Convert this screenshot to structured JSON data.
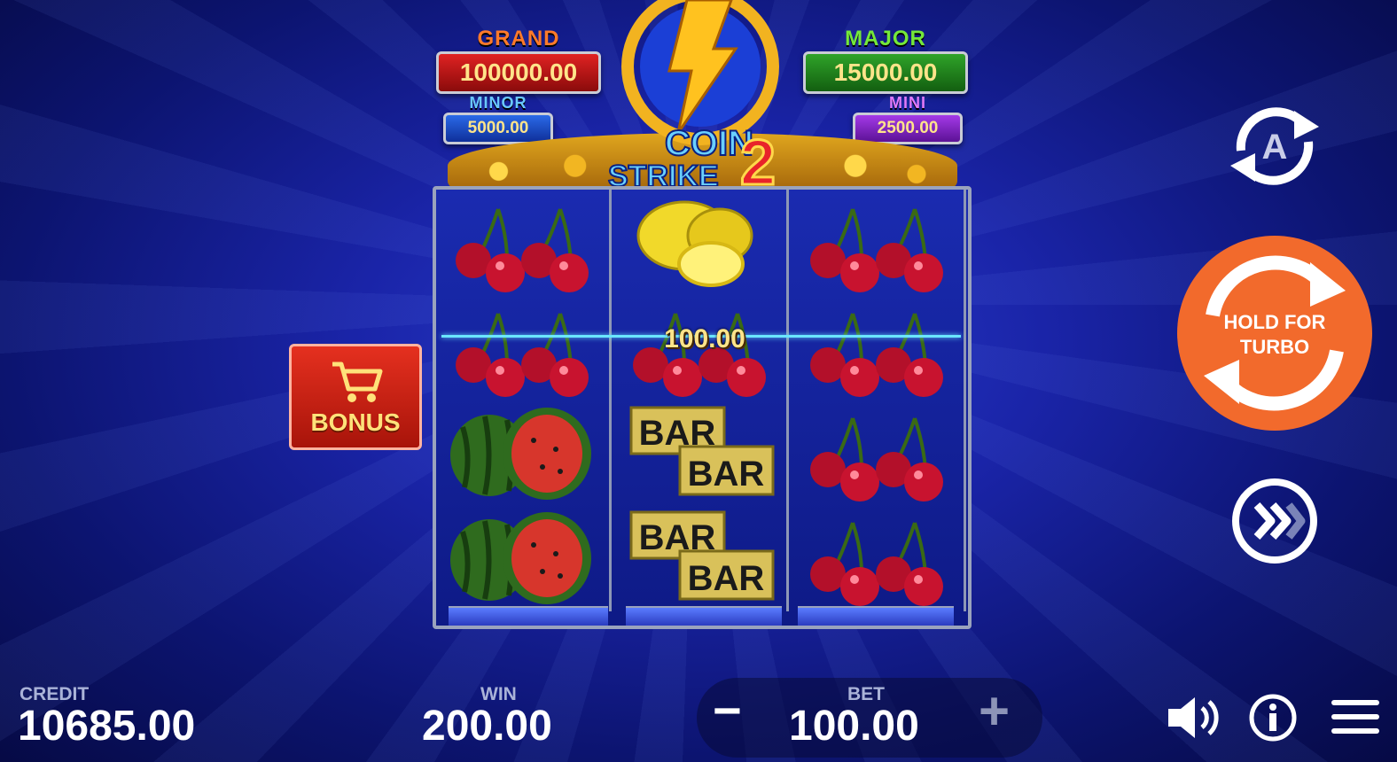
{
  "jackpots": {
    "grand": {
      "label": "GRAND",
      "value": "100000.00"
    },
    "major": {
      "label": "MAJOR",
      "value": "15000.00"
    },
    "minor": {
      "label": "MINOR",
      "value": "5000.00"
    },
    "mini": {
      "label": "MINI",
      "value": "2500.00"
    }
  },
  "logo": {
    "line1": "COIN",
    "line2": "STRIKE",
    "number": "2"
  },
  "reels": [
    [
      "cherry",
      "cherry",
      "watermelon",
      "watermelon"
    ],
    [
      "lemon",
      "cherry",
      "bar",
      "bar"
    ],
    [
      "cherry",
      "cherry",
      "cherry",
      "cherry"
    ]
  ],
  "coin_value": "100.00",
  "bonus_button": {
    "label": "BONUS",
    "icon": "cart-icon"
  },
  "spin_button": {
    "line1": "HOLD FOR",
    "line2": "TURBO"
  },
  "autoplay_button": {
    "label": "A"
  },
  "footer": {
    "credit_label": "CREDIT",
    "credit_value": "10685.00",
    "win_label": "WIN",
    "win_value": "200.00",
    "bet_label": "BET",
    "bet_value": "100.00",
    "bet_minus": "−",
    "bet_plus": "+"
  },
  "colors": {
    "spin": "#f26a2c",
    "bonus": "#e5301f",
    "payline": "#6ae6ff"
  }
}
